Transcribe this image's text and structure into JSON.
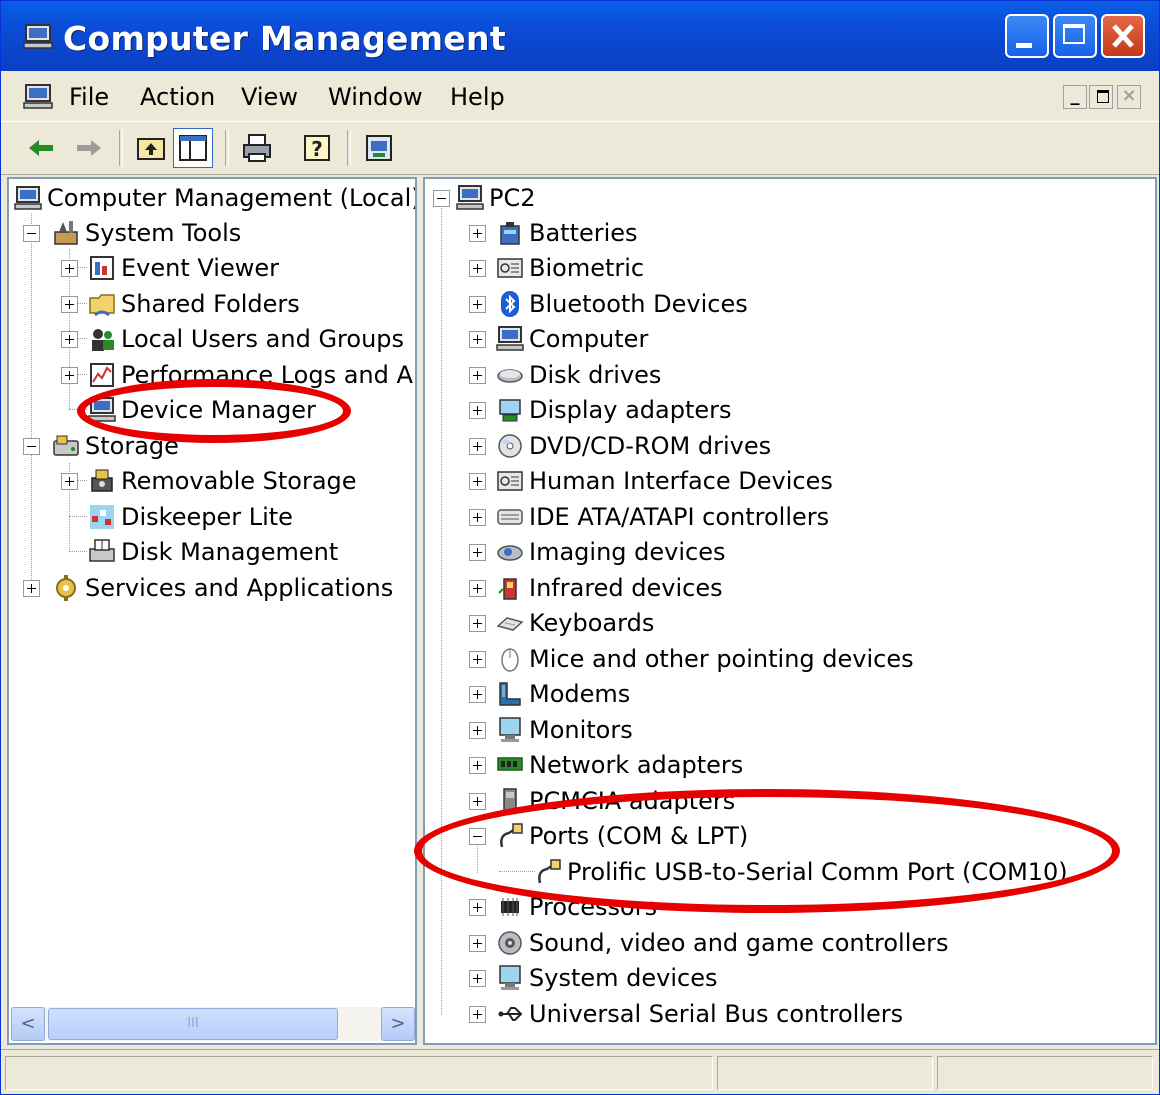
{
  "window": {
    "title": "Computer Management"
  },
  "menu": {
    "items": [
      "File",
      "Action",
      "View",
      "Window",
      "Help"
    ]
  },
  "toolbar": {
    "icons": [
      "back-arrow-icon",
      "forward-arrow-icon",
      "up-one-level-icon",
      "show-hide-console-tree-icon",
      "print-icon",
      "help-icon",
      "properties-icon"
    ]
  },
  "left_tree": [
    {
      "label": "Computer Management (Local)",
      "icon": "computer-management-icon"
    },
    {
      "label": "System Tools",
      "icon": "system-tools-icon"
    },
    {
      "label": "Event Viewer",
      "icon": "event-viewer-icon"
    },
    {
      "label": "Shared Folders",
      "icon": "shared-folders-icon"
    },
    {
      "label": "Local Users and Groups",
      "icon": "local-users-icon"
    },
    {
      "label": "Performance Logs and Alerts",
      "icon": "performance-logs-icon"
    },
    {
      "label": "Device Manager",
      "icon": "device-manager-icon"
    },
    {
      "label": "Storage",
      "icon": "storage-icon"
    },
    {
      "label": "Removable Storage",
      "icon": "removable-storage-icon"
    },
    {
      "label": "Diskeeper Lite",
      "icon": "diskeeper-icon"
    },
    {
      "label": "Disk Management",
      "icon": "disk-management-icon"
    },
    {
      "label": "Services and Applications",
      "icon": "services-applications-icon"
    }
  ],
  "right_tree": [
    {
      "label": "PC2",
      "icon": "computer-icon"
    },
    {
      "label": "Batteries",
      "icon": "batteries-icon"
    },
    {
      "label": "Biometric",
      "icon": "biometric-icon"
    },
    {
      "label": "Bluetooth Devices",
      "icon": "bluetooth-icon"
    },
    {
      "label": "Computer",
      "icon": "computer-icon"
    },
    {
      "label": "Disk drives",
      "icon": "disk-drive-icon"
    },
    {
      "label": "Display adapters",
      "icon": "display-adapter-icon"
    },
    {
      "label": "DVD/CD-ROM drives",
      "icon": "dvd-drive-icon"
    },
    {
      "label": "Human Interface Devices",
      "icon": "hid-icon"
    },
    {
      "label": "IDE ATA/ATAPI controllers",
      "icon": "ide-controller-icon"
    },
    {
      "label": "Imaging devices",
      "icon": "imaging-device-icon"
    },
    {
      "label": "Infrared devices",
      "icon": "infrared-icon"
    },
    {
      "label": "Keyboards",
      "icon": "keyboard-icon"
    },
    {
      "label": "Mice and other pointing devices",
      "icon": "mouse-icon"
    },
    {
      "label": "Modems",
      "icon": "modem-icon"
    },
    {
      "label": "Monitors",
      "icon": "monitor-icon"
    },
    {
      "label": "Network adapters",
      "icon": "network-adapter-icon"
    },
    {
      "label": "PCMCIA adapters",
      "icon": "pcmcia-icon"
    },
    {
      "label": "Ports (COM & LPT)",
      "icon": "port-icon"
    },
    {
      "label": "Prolific USB-to-Serial Comm Port (COM10)",
      "icon": "port-icon"
    },
    {
      "label": "Processors",
      "icon": "processor-icon"
    },
    {
      "label": "Sound, video and game controllers",
      "icon": "sound-icon"
    },
    {
      "label": "System devices",
      "icon": "system-devices-icon"
    },
    {
      "label": "Universal Serial Bus controllers",
      "icon": "usb-icon"
    }
  ],
  "scrollbar": {
    "left_arrow": "<",
    "right_arrow": ">",
    "grip": "III"
  },
  "colors": {
    "titlebar": "#0b4cd6",
    "annotation": "#e60000",
    "tree_line": "#a0a0a0"
  }
}
